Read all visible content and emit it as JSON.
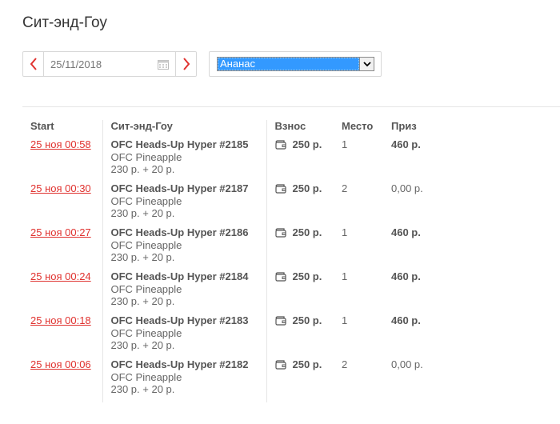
{
  "page": {
    "title": "Сит-энд-Гоу"
  },
  "filters": {
    "date": "25/11/2018",
    "game_select": {
      "selected": "Ананас"
    }
  },
  "table": {
    "headers": {
      "start": "Start",
      "name": "Сит-энд-Гоу",
      "fee": "Взнос",
      "place": "Место",
      "prize": "Приз"
    },
    "rows": [
      {
        "start": "25 ноя 00:58",
        "name": "OFC Heads-Up Hyper #2185",
        "game": "OFC Pineapple",
        "buyin": "230 р. + 20 р.",
        "fee": "250 р.",
        "place": "1",
        "prize": "460 р.",
        "prize_bold": true
      },
      {
        "start": "25 ноя 00:30",
        "name": "OFC Heads-Up Hyper #2187",
        "game": "OFC Pineapple",
        "buyin": "230 р. + 20 р.",
        "fee": "250 р.",
        "place": "2",
        "prize": "0,00 р.",
        "prize_bold": false
      },
      {
        "start": "25 ноя 00:27",
        "name": "OFC Heads-Up Hyper #2186",
        "game": "OFC Pineapple",
        "buyin": "230 р. + 20 р.",
        "fee": "250 р.",
        "place": "1",
        "prize": "460 р.",
        "prize_bold": true
      },
      {
        "start": "25 ноя 00:24",
        "name": "OFC Heads-Up Hyper #2184",
        "game": "OFC Pineapple",
        "buyin": "230 р. + 20 р.",
        "fee": "250 р.",
        "place": "1",
        "prize": "460 р.",
        "prize_bold": true
      },
      {
        "start": "25 ноя 00:18",
        "name": "OFC Heads-Up Hyper #2183",
        "game": "OFC Pineapple",
        "buyin": "230 р. + 20 р.",
        "fee": "250 р.",
        "place": "1",
        "prize": "460 р.",
        "prize_bold": true
      },
      {
        "start": "25 ноя 00:06",
        "name": "OFC Heads-Up Hyper #2182",
        "game": "OFC Pineapple",
        "buyin": "230 р. + 20 р.",
        "fee": "250 р.",
        "place": "2",
        "prize": "0,00 р.",
        "prize_bold": false
      }
    ]
  },
  "colors": {
    "link": "#e0322f",
    "select_highlight": "#3399ff"
  },
  "icons": {
    "prev": "chevron-left-icon",
    "next": "chevron-right-icon",
    "calendar": "calendar-icon",
    "fee": "wallet-icon",
    "dropdown": "dropdown-arrow-icon"
  }
}
